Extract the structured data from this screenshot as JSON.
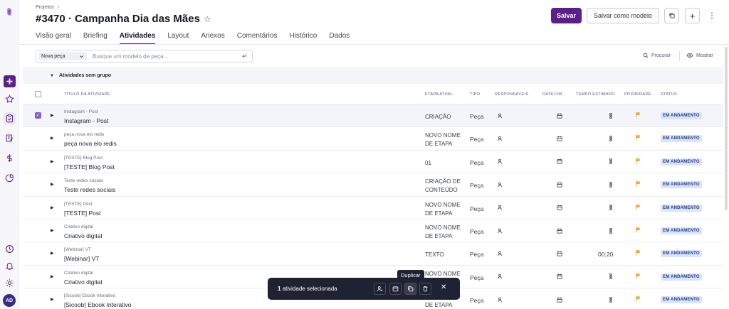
{
  "header": {
    "breadcrumb": "Projetos",
    "breadcrumb_sep": "›",
    "title": "#3470 · Campanha Dia das Mães",
    "star": "☆",
    "save_label": "Salvar",
    "save_template_label": "Salvar como modelo",
    "more": "⋮",
    "add": "+"
  },
  "tabs": [
    "Visão geral",
    "Briefing",
    "Atividades",
    "Layout",
    "Anexos",
    "Comentários",
    "Histórico",
    "Dados"
  ],
  "toolbar": {
    "piece_select": "Nova peça",
    "search_placeholder": "Busque um modelo de peça...",
    "enter": "↵",
    "search_label": "Procurar",
    "show_label": "Mostrar"
  },
  "group": {
    "title": "Atividades sem grupo"
  },
  "columns": {
    "title": "TÍTULO DA ATIVIDADE",
    "stage": "ETAPA ATUAL",
    "type": "TIPO",
    "assignees": "RESPONSÁVEIS",
    "end_date": "DATA FIM",
    "estimated": "TEMPO ESTIMADO",
    "priority": "PRIORIDADE",
    "status": "STATUS"
  },
  "rows": [
    {
      "sub": "Instagram - Post",
      "name": "Instagram - Post",
      "stage": [
        "CRIAÇÃO"
      ],
      "type": "Peça",
      "time": "",
      "status": "EM ANDAMENTO",
      "checked": true
    },
    {
      "sub": "peça nova elo redis",
      "name": "peça nova elo redis",
      "stage": [
        "NOVO NOME",
        "DE ETAPA"
      ],
      "type": "Peça",
      "time": "",
      "status": "EM ANDAMENTO",
      "checked": false
    },
    {
      "sub": "[TESTE] Blog Post",
      "name": "[TESTE] Blog Post",
      "stage": [
        "01"
      ],
      "type": "Peça",
      "time": "",
      "status": "EM ANDAMENTO",
      "checked": false
    },
    {
      "sub": "Teste redes sociais",
      "name": "Teste redes sociais",
      "stage": [
        "CRIAÇÃO DE",
        "CONTEÚDO"
      ],
      "type": "Peça",
      "time": "",
      "status": "EM ANDAMENTO",
      "checked": false
    },
    {
      "sub": "[TESTE] Post",
      "name": "[TESTE] Post",
      "stage": [
        "NOVO NOME",
        "DE ETAPA"
      ],
      "type": "Peça",
      "time": "",
      "status": "EM ANDAMENTO",
      "checked": false
    },
    {
      "sub": "Criativo digital",
      "name": "Criativo digital",
      "stage": [
        "NOVO NOME",
        "DE ETAPA"
      ],
      "type": "Peça",
      "time": "",
      "status": "EM ANDAMENTO",
      "checked": false
    },
    {
      "sub": "[Webinar] VT",
      "name": "[Webinar] VT",
      "stage": [
        "TEXTO"
      ],
      "type": "Peça",
      "time": "00:20",
      "status": "EM ANDAMENTO",
      "checked": false
    },
    {
      "sub": "Criativo digital",
      "name": "Criativo digital",
      "stage": [
        "NOVO NOME",
        "DE ETAPA"
      ],
      "type": "Peça",
      "time": "",
      "status": "EM ANDAMENTO",
      "checked": false
    },
    {
      "sub": "[Sicoob] Ebook Interativo",
      "name": "[Sicoob] Ebook Interativo",
      "stage": [
        "NOVO NOME",
        "DE ETAPA"
      ],
      "type": "Peça",
      "time": "",
      "status": "EM ANDAMENTO",
      "checked": false
    }
  ],
  "selection_bar": {
    "count": "1",
    "count_label": "atividade selecionada",
    "tooltip": "Duplicar",
    "close": "✕"
  },
  "colors": {
    "brand": "#5b1e8a",
    "status_bg": "#d9e4fb",
    "status_text": "#1e3a8a",
    "flag": "#f5a623",
    "checkbox": "#8a5cc9"
  },
  "icons": {
    "rail": [
      "paperclip-icon",
      "plus-icon",
      "star-icon",
      "clipboard-icon",
      "edit-icon",
      "dollar-icon",
      "pie-chart-icon",
      "clock-icon",
      "bell-icon",
      "gear-icon"
    ],
    "avatar": "AD"
  }
}
